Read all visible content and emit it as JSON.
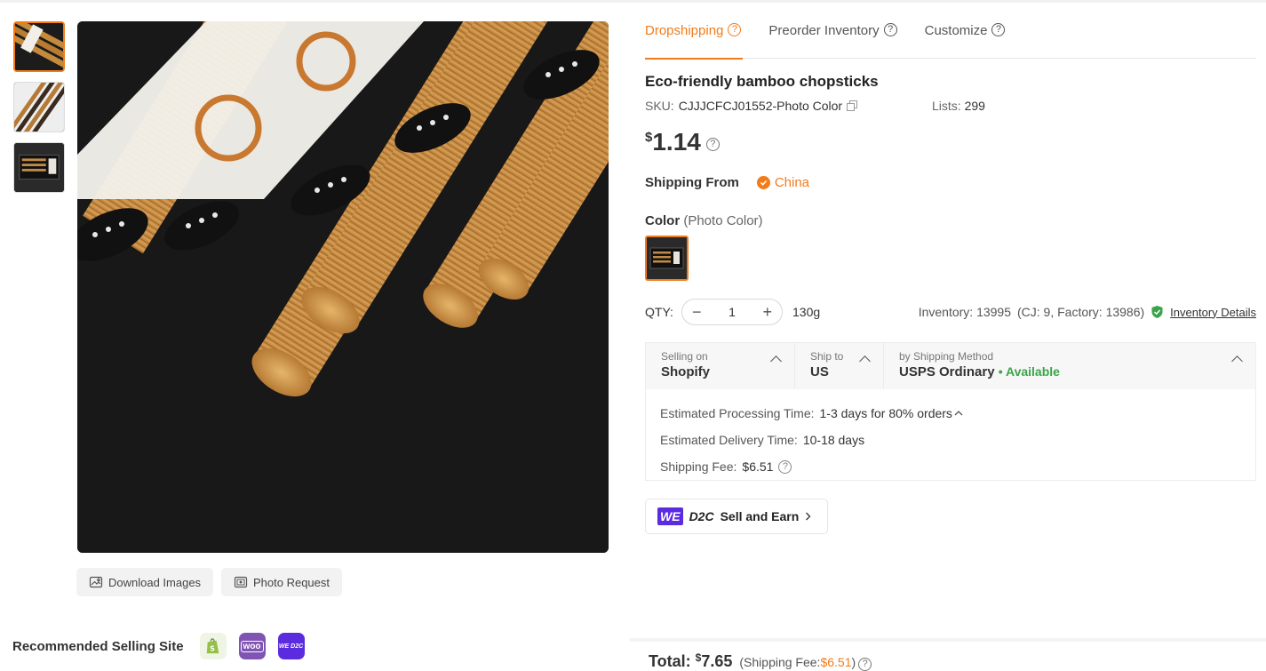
{
  "product": {
    "title": "Eco-friendly bamboo chopsticks",
    "sku_label": "SKU:",
    "sku": "CJJJCFCJ01552-Photo Color",
    "lists_label": "Lists:",
    "lists": "299",
    "price_currency": "$",
    "price": "1.14"
  },
  "tabs": [
    {
      "label": "Dropshipping",
      "active": true
    },
    {
      "label": "Preorder Inventory",
      "active": false
    },
    {
      "label": "Customize",
      "active": false
    }
  ],
  "shipping_from": {
    "label": "Shipping From",
    "country": "China"
  },
  "color": {
    "label": "Color",
    "selected": "(Photo Color)"
  },
  "qty": {
    "label": "QTY:",
    "value": "1",
    "minus": "−",
    "plus": "+",
    "weight": "130g",
    "inventory": "Inventory: 13995",
    "inventory_detail": "(CJ: 9, Factory: 13986)",
    "inventory_link": "Inventory Details"
  },
  "shipping": {
    "selling_on_label": "Selling on",
    "selling_on": "Shopify",
    "ship_to_label": "Ship to",
    "ship_to": "US",
    "method_label": "by Shipping Method",
    "method": "USPS Ordinary",
    "availability": "• Available",
    "processing_label": "Estimated Processing Time:",
    "processing": "1-3 days for 80% orders",
    "delivery_label": "Estimated Delivery Time:",
    "delivery": "10-18 days",
    "fee_label": "Shipping Fee:",
    "fee": "$6.51"
  },
  "wed2c": {
    "we": "WE",
    "d2c": "D2C",
    "label": "Sell and Earn"
  },
  "image_actions": {
    "download": "Download Images",
    "photo_request": "Photo Request"
  },
  "recommended": {
    "label": "Recommended Selling Site",
    "woo": "woo",
    "wed2c": "WE D2C"
  },
  "total": {
    "label": "Total:",
    "currency": "$",
    "amount": "7.65",
    "fee_prefix": "(Shipping Fee: ",
    "fee": "$6.51",
    "fee_suffix": ")"
  },
  "colors": {
    "accent": "#f27b1a",
    "available": "#3aa44a",
    "wed2c": "#5b2be0",
    "shopify": "#95bf47",
    "woo": "#7f54b3"
  }
}
